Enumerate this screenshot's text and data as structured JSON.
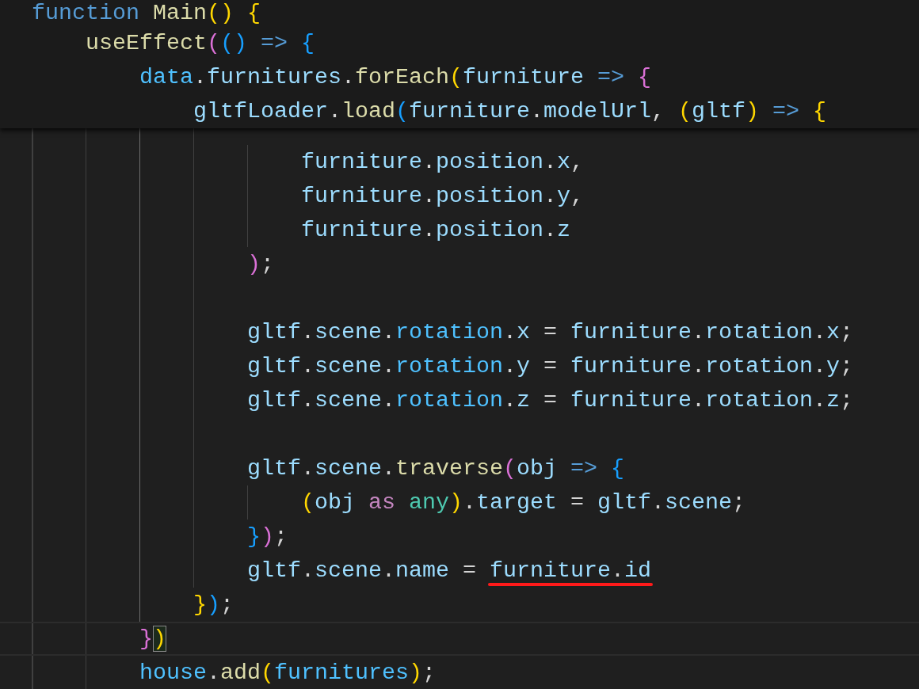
{
  "sticky_lines": [
    {
      "tokens": [
        {
          "text": "function",
          "kind": "keyword"
        },
        {
          "text": " Main",
          "kind": "function"
        },
        {
          "text": "(",
          "kind": "bracket1"
        },
        {
          "text": ")",
          "kind": "bracket1"
        },
        {
          "text": " {",
          "kind": "bracket1"
        }
      ]
    },
    {
      "tokens": [
        {
          "text": "    useEffect",
          "kind": "function"
        },
        {
          "text": "(",
          "kind": "bracket2"
        },
        {
          "text": "(",
          "kind": "bracket3"
        },
        {
          "text": ")",
          "kind": "bracket3"
        },
        {
          "text": " =>",
          "kind": "keyword"
        },
        {
          "text": " {",
          "kind": "bracket3"
        }
      ]
    },
    {
      "tokens": [
        {
          "text": "        data",
          "kind": "constant"
        },
        {
          "text": ".",
          "kind": "plain"
        },
        {
          "text": "furnitures",
          "kind": "variable"
        },
        {
          "text": ".",
          "kind": "plain"
        },
        {
          "text": "forEach",
          "kind": "function"
        },
        {
          "text": "(",
          "kind": "bracket1"
        },
        {
          "text": "furniture",
          "kind": "variable"
        },
        {
          "text": " =>",
          "kind": "keyword"
        },
        {
          "text": " {",
          "kind": "bracket2"
        }
      ]
    },
    {
      "tokens": [
        {
          "text": "            gltfLoader",
          "kind": "variable"
        },
        {
          "text": ".",
          "kind": "plain"
        },
        {
          "text": "load",
          "kind": "function"
        },
        {
          "text": "(",
          "kind": "bracket3"
        },
        {
          "text": "furniture",
          "kind": "variable"
        },
        {
          "text": ".",
          "kind": "plain"
        },
        {
          "text": "modelUrl",
          "kind": "variable"
        },
        {
          "text": ",",
          "kind": "plain"
        },
        {
          "text": " (",
          "kind": "bracket1"
        },
        {
          "text": "gltf",
          "kind": "variable"
        },
        {
          "text": ")",
          "kind": "bracket1"
        },
        {
          "text": " =>",
          "kind": "keyword"
        },
        {
          "text": " {",
          "kind": "bracket1"
        }
      ]
    }
  ],
  "lines": [
    {
      "kind": "code",
      "current": false,
      "tokens": [
        {
          "text": "                    furniture",
          "kind": "variable"
        },
        {
          "text": ".",
          "kind": "plain"
        },
        {
          "text": "position",
          "kind": "variable"
        },
        {
          "text": ".",
          "kind": "plain"
        },
        {
          "text": "x",
          "kind": "variable"
        },
        {
          "text": ",",
          "kind": "plain"
        }
      ]
    },
    {
      "kind": "code",
      "current": false,
      "tokens": [
        {
          "text": "                    furniture",
          "kind": "variable"
        },
        {
          "text": ".",
          "kind": "plain"
        },
        {
          "text": "position",
          "kind": "variable"
        },
        {
          "text": ".",
          "kind": "plain"
        },
        {
          "text": "y",
          "kind": "variable"
        },
        {
          "text": ",",
          "kind": "plain"
        }
      ]
    },
    {
      "kind": "code",
      "current": false,
      "tokens": [
        {
          "text": "                    furniture",
          "kind": "variable"
        },
        {
          "text": ".",
          "kind": "plain"
        },
        {
          "text": "position",
          "kind": "variable"
        },
        {
          "text": ".",
          "kind": "plain"
        },
        {
          "text": "z",
          "kind": "variable"
        }
      ]
    },
    {
      "kind": "code",
      "current": false,
      "tokens": [
        {
          "text": "                )",
          "kind": "bracket2"
        },
        {
          "text": ";",
          "kind": "plain"
        }
      ]
    },
    {
      "kind": "blank"
    },
    {
      "kind": "code",
      "current": false,
      "tokens": [
        {
          "text": "                gltf",
          "kind": "variable"
        },
        {
          "text": ".",
          "kind": "plain"
        },
        {
          "text": "scene",
          "kind": "variable"
        },
        {
          "text": ".",
          "kind": "plain"
        },
        {
          "text": "rotation",
          "kind": "constant"
        },
        {
          "text": ".",
          "kind": "plain"
        },
        {
          "text": "x",
          "kind": "variable"
        },
        {
          "text": " = ",
          "kind": "plain"
        },
        {
          "text": "furniture",
          "kind": "variable"
        },
        {
          "text": ".",
          "kind": "plain"
        },
        {
          "text": "rotation",
          "kind": "variable"
        },
        {
          "text": ".",
          "kind": "plain"
        },
        {
          "text": "x",
          "kind": "variable"
        },
        {
          "text": ";",
          "kind": "plain"
        }
      ]
    },
    {
      "kind": "code",
      "current": false,
      "tokens": [
        {
          "text": "                gltf",
          "kind": "variable"
        },
        {
          "text": ".",
          "kind": "plain"
        },
        {
          "text": "scene",
          "kind": "variable"
        },
        {
          "text": ".",
          "kind": "plain"
        },
        {
          "text": "rotation",
          "kind": "constant"
        },
        {
          "text": ".",
          "kind": "plain"
        },
        {
          "text": "y",
          "kind": "variable"
        },
        {
          "text": " = ",
          "kind": "plain"
        },
        {
          "text": "furniture",
          "kind": "variable"
        },
        {
          "text": ".",
          "kind": "plain"
        },
        {
          "text": "rotation",
          "kind": "variable"
        },
        {
          "text": ".",
          "kind": "plain"
        },
        {
          "text": "y",
          "kind": "variable"
        },
        {
          "text": ";",
          "kind": "plain"
        }
      ]
    },
    {
      "kind": "code",
      "current": false,
      "tokens": [
        {
          "text": "                gltf",
          "kind": "variable"
        },
        {
          "text": ".",
          "kind": "plain"
        },
        {
          "text": "scene",
          "kind": "variable"
        },
        {
          "text": ".",
          "kind": "plain"
        },
        {
          "text": "rotation",
          "kind": "constant"
        },
        {
          "text": ".",
          "kind": "plain"
        },
        {
          "text": "z",
          "kind": "variable"
        },
        {
          "text": " = ",
          "kind": "plain"
        },
        {
          "text": "furniture",
          "kind": "variable"
        },
        {
          "text": ".",
          "kind": "plain"
        },
        {
          "text": "rotation",
          "kind": "variable"
        },
        {
          "text": ".",
          "kind": "plain"
        },
        {
          "text": "z",
          "kind": "variable"
        },
        {
          "text": ";",
          "kind": "plain"
        }
      ]
    },
    {
      "kind": "blank"
    },
    {
      "kind": "code",
      "current": false,
      "tokens": [
        {
          "text": "                gltf",
          "kind": "variable"
        },
        {
          "text": ".",
          "kind": "plain"
        },
        {
          "text": "scene",
          "kind": "variable"
        },
        {
          "text": ".",
          "kind": "plain"
        },
        {
          "text": "traverse",
          "kind": "function"
        },
        {
          "text": "(",
          "kind": "bracket2"
        },
        {
          "text": "obj",
          "kind": "variable"
        },
        {
          "text": " =>",
          "kind": "keyword"
        },
        {
          "text": " {",
          "kind": "bracket3"
        }
      ]
    },
    {
      "kind": "code",
      "current": false,
      "tokens": [
        {
          "text": "                    (",
          "kind": "bracket1"
        },
        {
          "text": "obj",
          "kind": "variable"
        },
        {
          "text": " as",
          "kind": "control"
        },
        {
          "text": " any",
          "kind": "type"
        },
        {
          "text": ")",
          "kind": "bracket1"
        },
        {
          "text": ".",
          "kind": "plain"
        },
        {
          "text": "target",
          "kind": "variable"
        },
        {
          "text": " = ",
          "kind": "plain"
        },
        {
          "text": "gltf",
          "kind": "variable"
        },
        {
          "text": ".",
          "kind": "plain"
        },
        {
          "text": "scene",
          "kind": "variable"
        },
        {
          "text": ";",
          "kind": "plain"
        }
      ]
    },
    {
      "kind": "code",
      "current": false,
      "tokens": [
        {
          "text": "                }",
          "kind": "bracket3"
        },
        {
          "text": ")",
          "kind": "bracket2"
        },
        {
          "text": ";",
          "kind": "plain"
        }
      ]
    },
    {
      "kind": "code",
      "current": false,
      "tokens": [
        {
          "text": "                gltf",
          "kind": "variable"
        },
        {
          "text": ".",
          "kind": "plain"
        },
        {
          "text": "scene",
          "kind": "variable"
        },
        {
          "text": ".",
          "kind": "plain"
        },
        {
          "text": "name",
          "kind": "variable"
        },
        {
          "text": " = ",
          "kind": "plain"
        },
        {
          "text": "furniture",
          "kind": "variable",
          "underlined": true
        },
        {
          "text": ".",
          "kind": "plain",
          "underlined": true
        },
        {
          "text": "id",
          "kind": "variable",
          "underlined": true
        }
      ]
    },
    {
      "kind": "code",
      "current": false,
      "tokens": [
        {
          "text": "            }",
          "kind": "bracket1"
        },
        {
          "text": ")",
          "kind": "bracket3"
        },
        {
          "text": ";",
          "kind": "plain"
        }
      ]
    },
    {
      "kind": "code",
      "current": true,
      "tokens": [
        {
          "text": "        }",
          "kind": "bracket2"
        },
        {
          "text": ")",
          "kind": "bracket1",
          "matched": true
        }
      ]
    },
    {
      "kind": "code",
      "current": false,
      "tokens": [
        {
          "text": "        house",
          "kind": "constant"
        },
        {
          "text": ".",
          "kind": "plain"
        },
        {
          "text": "add",
          "kind": "function"
        },
        {
          "text": "(",
          "kind": "bracket1"
        },
        {
          "text": "furnitures",
          "kind": "constant"
        },
        {
          "text": ")",
          "kind": "bracket1"
        },
        {
          "text": ";",
          "kind": "plain"
        }
      ]
    }
  ]
}
